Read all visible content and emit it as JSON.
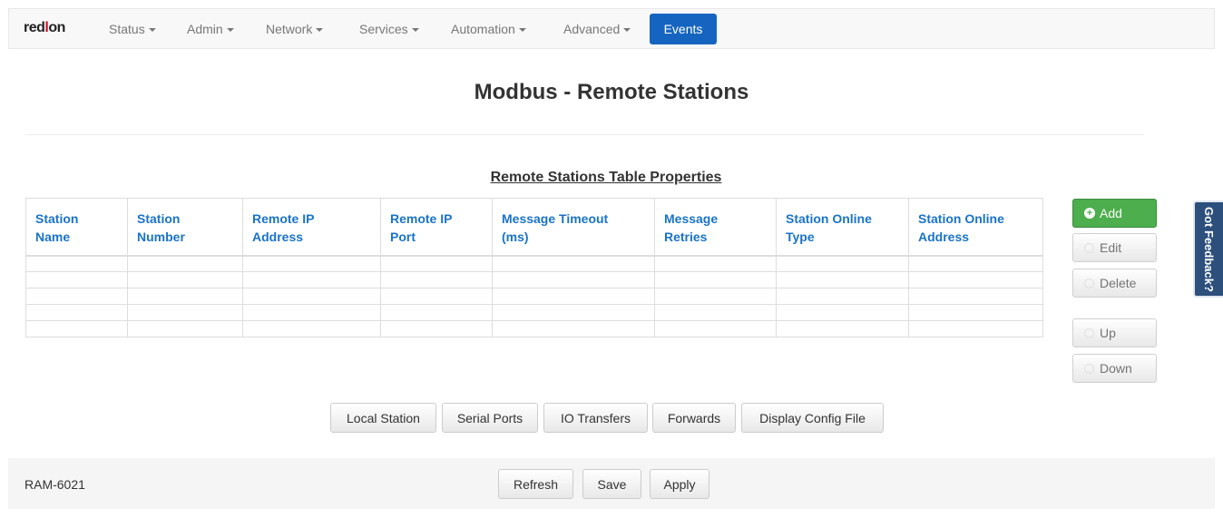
{
  "navbar": {
    "brand_a": "red",
    "brand_b": "l",
    "brand_c": "on",
    "menus": [
      "Status",
      "Admin",
      "Network",
      "Services",
      "Automation",
      "Advanced"
    ],
    "events_label": "Events"
  },
  "page": {
    "title": "Modbus - Remote Stations",
    "table_title": "Remote Stations Table Properties"
  },
  "table": {
    "columns": [
      [
        "Station",
        "Name"
      ],
      [
        "Station",
        "Number"
      ],
      [
        "Remote IP",
        "Address"
      ],
      [
        "Remote IP",
        "Port"
      ],
      [
        "Message Timeout",
        "(ms)"
      ],
      [
        "Message",
        "Retries"
      ],
      [
        "Station Online",
        "Type"
      ],
      [
        "Station Online",
        "Address"
      ]
    ],
    "row_count": 5
  },
  "actions": {
    "add": "Add",
    "edit": "Edit",
    "delete": "Delete",
    "up": "Up",
    "down": "Down"
  },
  "feedback_label": "Got Feedback?",
  "nav_buttons": {
    "local_station": "Local Station",
    "serial_ports": "Serial Ports",
    "io_transfers": "IO Transfers",
    "forwards": "Forwards",
    "display_config": "Display Config File"
  },
  "footer": {
    "model": "RAM-6021",
    "refresh": "Refresh",
    "save": "Save",
    "apply": "Apply"
  },
  "colors": {
    "accent": "#1565c0",
    "add_green": "#4cae4c",
    "header_text": "#1a73c8",
    "feedback_bg": "#2c4f7c"
  }
}
